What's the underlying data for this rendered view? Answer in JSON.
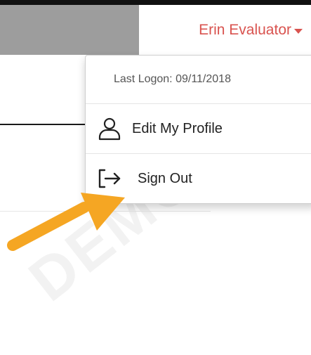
{
  "header": {
    "user_name": "Erin Evaluator",
    "accent_color": "#d9534f"
  },
  "user_menu": {
    "last_logon": "Last Logon: 09/11/2018",
    "items": [
      {
        "label": "Edit My Profile",
        "icon": "user-icon"
      },
      {
        "label": "Sign Out",
        "icon": "sign-out-icon"
      }
    ]
  },
  "annotation": {
    "arrow_color": "#f5a623"
  }
}
